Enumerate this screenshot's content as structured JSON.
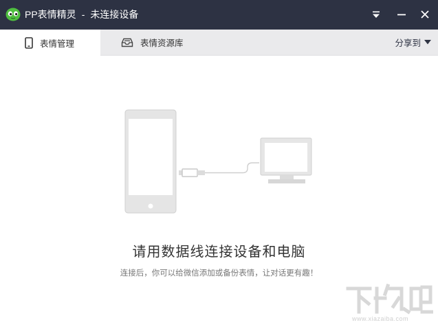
{
  "window": {
    "app_name": "PP表情精灵",
    "separator": "-",
    "status": "未连接设备",
    "logo_icon": "green-alien-face-icon",
    "accent_color": "#2d3243"
  },
  "tabs": [
    {
      "label": "表情管理",
      "icon": "phone-icon",
      "active": true
    },
    {
      "label": "表情资源库",
      "icon": "tray-icon",
      "active": false
    }
  ],
  "share": {
    "label": "分享到",
    "icon": "caret-down-icon"
  },
  "main": {
    "headline": "请用数据线连接设备和电脑",
    "subline": "连接后，你可以给微信添加或备份表情，让对话更有趣！",
    "illustration": [
      "phone-icon",
      "usb-cable-icon",
      "monitor-icon"
    ]
  },
  "watermark": {
    "text": "下载吧",
    "url": "www.xiazaiba.com"
  }
}
